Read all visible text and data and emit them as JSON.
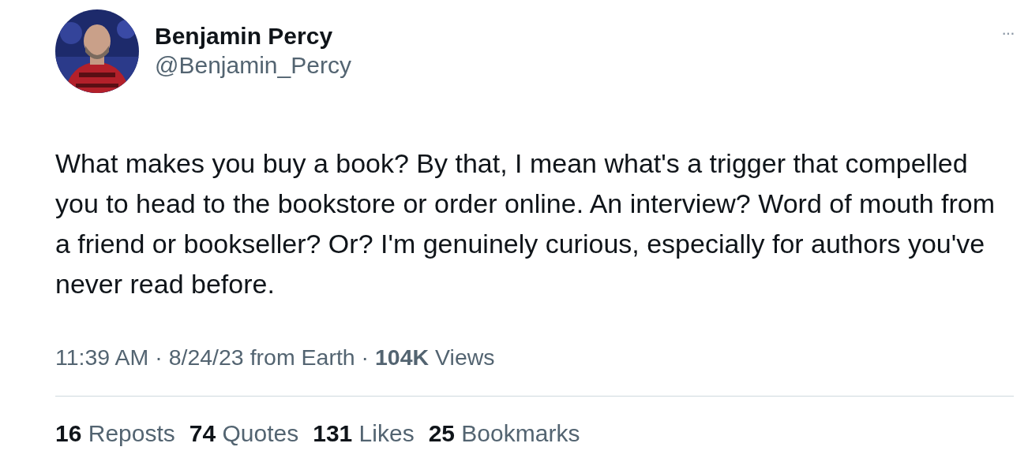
{
  "author": {
    "name": "Benjamin Percy",
    "handle": "@Benjamin_Percy"
  },
  "more_menu": "···",
  "text": "What makes you buy a book? By that, I mean what's a trigger that compelled you to head to the bookstore or order online. An interview? Word of mouth from a friend or bookseller? Or? I'm genuinely curious, especially for authors you've never read before.",
  "meta": "11:39 AM · 8/24/23 from Earth · **104K** Views",
  "stats": [
    {
      "count": "16",
      "label": "Reposts"
    },
    {
      "count": "74",
      "label": "Quotes"
    },
    {
      "count": "131",
      "label": "Likes"
    },
    {
      "count": "25",
      "label": "Bookmarks"
    }
  ]
}
